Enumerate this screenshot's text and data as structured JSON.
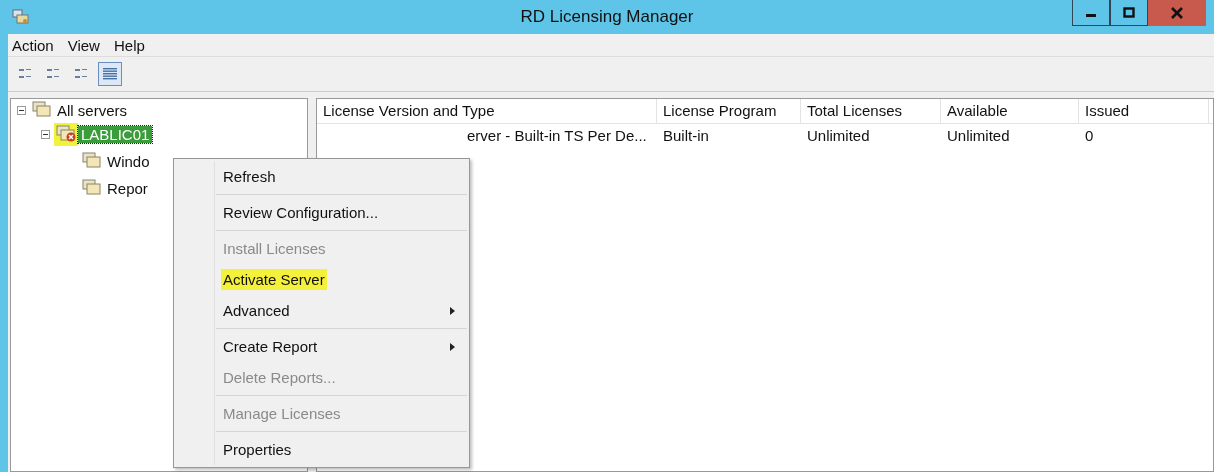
{
  "window": {
    "title": "RD Licensing Manager"
  },
  "menu_bar": [
    "Action",
    "View",
    "Help"
  ],
  "toolbar": [
    {
      "selected": false
    },
    {
      "selected": false
    },
    {
      "selected": false
    },
    {
      "selected": true
    }
  ],
  "tree": [
    {
      "label": "All servers",
      "expanded": true,
      "selected": false,
      "highlighted": false,
      "children": [
        {
          "label": "LABLIC01",
          "expanded": true,
          "selected": true,
          "highlighted": true,
          "error": true,
          "children": [
            {
              "label": "Windo",
              "selected": false,
              "highlighted": false
            },
            {
              "label": "Repor",
              "selected": false,
              "highlighted": false
            }
          ]
        }
      ]
    }
  ],
  "table": {
    "columns": [
      "License Version and Type",
      "License Program",
      "Total Licenses",
      "Available",
      "Issued"
    ],
    "rows": [
      [
        "erver - Built-in TS Per De...",
        "Built-in",
        "Unlimited",
        "Unlimited",
        "0"
      ]
    ]
  },
  "context_menu": [
    {
      "kind": "item",
      "label": "Refresh",
      "disabled": false,
      "highlighted": false,
      "submenu": false
    },
    {
      "kind": "separator"
    },
    {
      "kind": "item",
      "label": "Review Configuration...",
      "disabled": false,
      "highlighted": false,
      "submenu": false
    },
    {
      "kind": "separator"
    },
    {
      "kind": "item",
      "label": "Install Licenses",
      "disabled": true,
      "highlighted": false,
      "submenu": false
    },
    {
      "kind": "item",
      "label": "Activate Server",
      "disabled": false,
      "highlighted": true,
      "submenu": false
    },
    {
      "kind": "item",
      "label": "Advanced",
      "disabled": false,
      "highlighted": false,
      "submenu": true
    },
    {
      "kind": "separator"
    },
    {
      "kind": "item",
      "label": "Create Report",
      "disabled": false,
      "highlighted": false,
      "submenu": true
    },
    {
      "kind": "item",
      "label": "Delete Reports...",
      "disabled": true,
      "highlighted": false,
      "submenu": false
    },
    {
      "kind": "separator"
    },
    {
      "kind": "item",
      "label": "Manage Licenses",
      "disabled": true,
      "highlighted": false,
      "submenu": false
    },
    {
      "kind": "separator"
    },
    {
      "kind": "item",
      "label": "Properties",
      "disabled": false,
      "highlighted": false,
      "submenu": false
    }
  ]
}
